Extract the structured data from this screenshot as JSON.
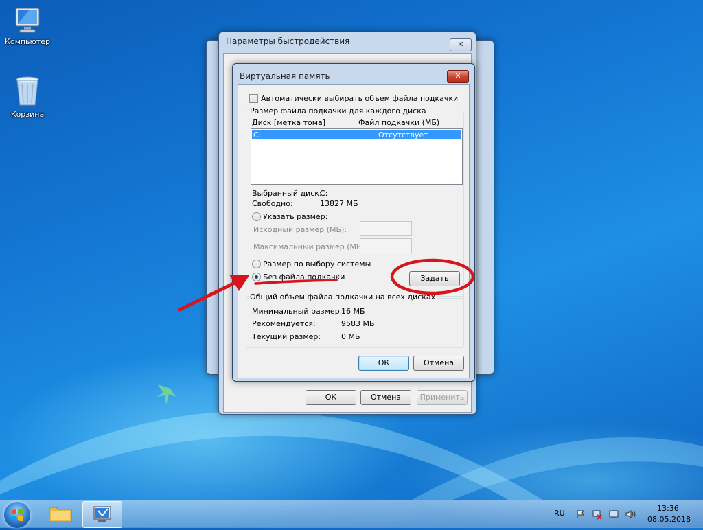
{
  "desktop": {
    "icons": [
      {
        "label": "Компьютер",
        "icon": "computer-icon"
      },
      {
        "label": "Корзина",
        "icon": "recycle-bin-icon"
      }
    ]
  },
  "perf_window": {
    "title": "Параметры быстродействия",
    "close_label": "✕",
    "ok_label": "ОК",
    "cancel_label": "Отмена",
    "apply_label": "Применить"
  },
  "vm_dialog": {
    "title": "Виртуальная память",
    "close_label": "✕",
    "auto_manage_label": "Автоматически выбирать объем файла подкачки",
    "auto_manage_checked": false,
    "per_drive_group_label": "Размер файла подкачки для каждого диска",
    "drive_list": {
      "col_drive": "Диск [метка тома]",
      "col_paging": "Файл подкачки (МБ)",
      "rows": [
        {
          "drive": "C:",
          "paging": "Отсутствует",
          "selected": true
        }
      ]
    },
    "selected_drive_label": "Выбранный диск:",
    "selected_drive_value": "C:",
    "free_space_label": "Свободно:",
    "free_space_value": "13827 МБ",
    "custom_size_label": "Указать размер:",
    "initial_size_label": "Исходный размер (МБ):",
    "initial_size_value": "",
    "max_size_label": "Максимальный размер (МБ):",
    "max_size_value": "",
    "system_managed_label": "Размер по выбору системы",
    "no_paging_label": "Без файла подкачки",
    "selected_option": "no_paging",
    "set_button_label": "Задать",
    "total_group_label": "Общий объем файла подкачки на всех дисках",
    "min_size_label": "Минимальный размер:",
    "min_size_value": "16 МБ",
    "recommended_label": "Рекомендуется:",
    "recommended_value": "9583 МБ",
    "current_label": "Текущий размер:",
    "current_value": "0 МБ",
    "ok_label": "ОК",
    "cancel_label": "Отмена"
  },
  "annotation": {
    "color": "#d8141c"
  },
  "taskbar": {
    "language": "RU",
    "time": "13:36",
    "date": "08.05.2018",
    "pinned": [
      "start-orb",
      "explorer-icon",
      "system-properties-icon"
    ]
  }
}
